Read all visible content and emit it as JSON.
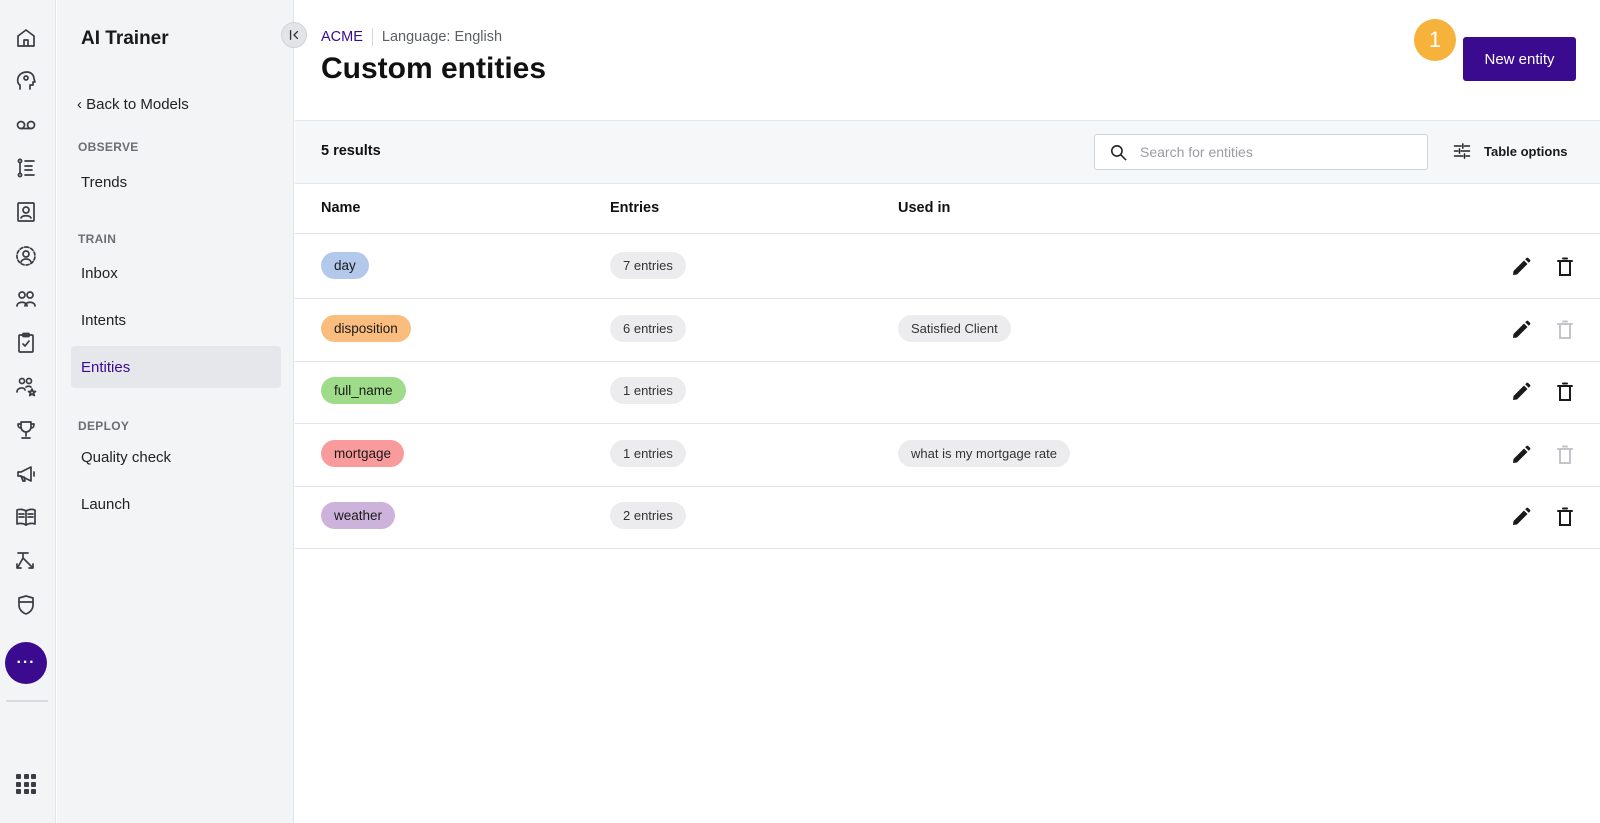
{
  "sidebar": {
    "title": "AI Trainer",
    "back_label": "Back to Models",
    "sections": [
      {
        "label": "OBSERVE",
        "items": [
          {
            "label": "Trends"
          }
        ]
      },
      {
        "label": "TRAIN",
        "items": [
          {
            "label": "Inbox"
          },
          {
            "label": "Intents"
          },
          {
            "label": "Entities"
          }
        ]
      },
      {
        "label": "DEPLOY",
        "items": [
          {
            "label": "Quality check"
          },
          {
            "label": "Launch"
          }
        ]
      }
    ],
    "active_item": "Entities"
  },
  "rail": {
    "icons": [
      "home-icon",
      "brain-head-icon",
      "voicemail-icon",
      "list-steps-icon",
      "contact-card-icon",
      "agent-ring-icon",
      "people-icon",
      "clipboard-check-icon",
      "people-star-icon",
      "trophy-icon",
      "megaphone-icon",
      "book-icon",
      "flow-icon",
      "shield-icon"
    ],
    "more_label": "···"
  },
  "header": {
    "org": "ACME",
    "language": "Language: English",
    "title": "Custom entities",
    "badge": "1",
    "new_button": "New entity"
  },
  "toolbar": {
    "results": "5 results",
    "search_placeholder": "Search for entities",
    "table_options": "Table options"
  },
  "table": {
    "columns": [
      "Name",
      "Entries",
      "Used in"
    ],
    "rows": [
      {
        "name": "day",
        "color": "#b3c9ec",
        "entries": "7 entries",
        "used_in": "",
        "delete_enabled": true
      },
      {
        "name": "disposition",
        "color": "#fbbd7e",
        "entries": "6 entries",
        "used_in": "Satisfied Client",
        "delete_enabled": false
      },
      {
        "name": "full_name",
        "color": "#9fdc8a",
        "entries": "1 entries",
        "used_in": "",
        "delete_enabled": true
      },
      {
        "name": "mortgage",
        "color": "#f99a9c",
        "entries": "1 entries",
        "used_in": "what is my mortgage rate",
        "delete_enabled": false
      },
      {
        "name": "weather",
        "color": "#cdb3dc",
        "entries": "2 entries",
        "used_in": "",
        "delete_enabled": true
      }
    ]
  },
  "colors": {
    "accent": "#3a0b8f",
    "badge": "#f6b23a"
  }
}
